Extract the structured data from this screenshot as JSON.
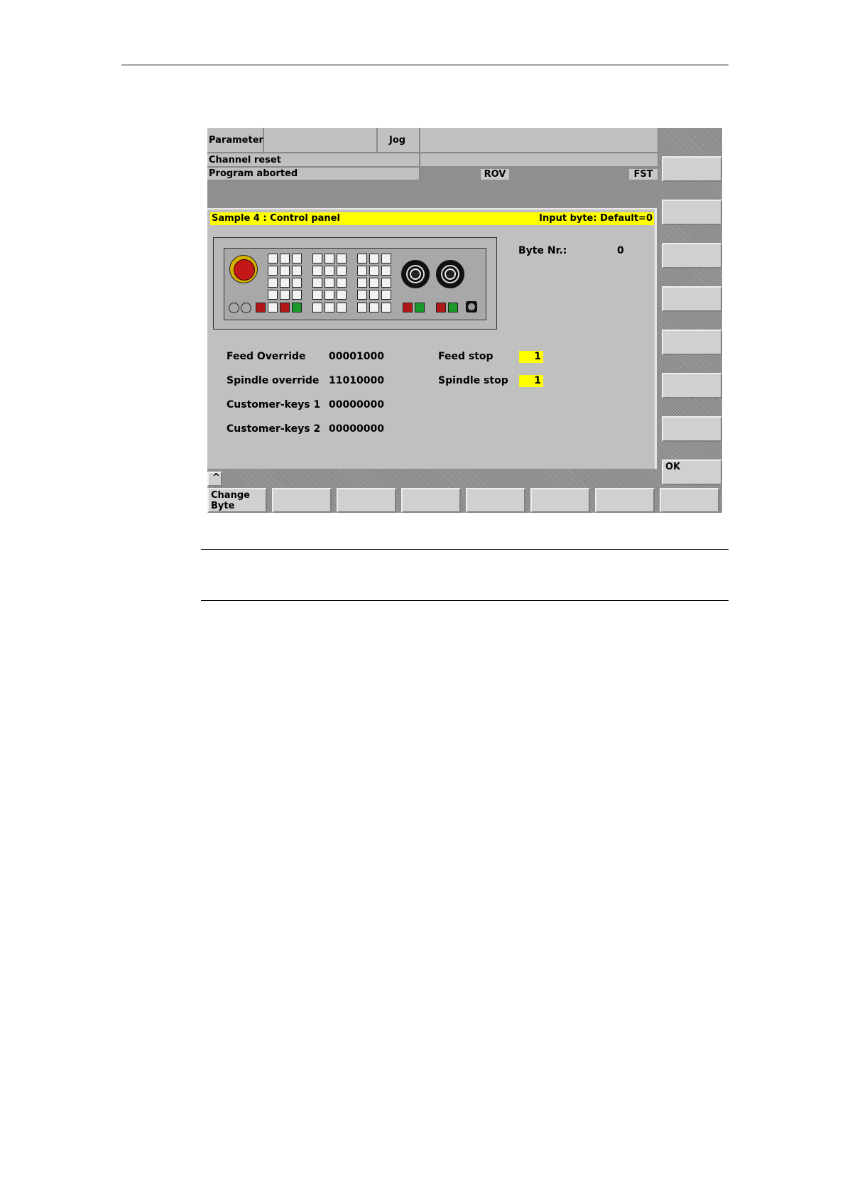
{
  "header": {
    "area": "Parameter",
    "mode": "Jog",
    "channel_status": "Channel reset",
    "program_status": "Program aborted",
    "indicator_1": "ROV",
    "indicator_2": "FST"
  },
  "dialog": {
    "title": "Sample 4 : Control panel",
    "input_info": "Input byte: Default=0",
    "byte_label": "Byte Nr.:",
    "byte_value": "0",
    "rows": [
      {
        "label": "Feed Override",
        "value": "00001000"
      },
      {
        "label": "Spindle override",
        "value": "11010000"
      },
      {
        "label": "Customer-keys 1",
        "value": "00000000"
      },
      {
        "label": "Customer-keys 2",
        "value": "00000000"
      }
    ],
    "flags": [
      {
        "label": "Feed stop",
        "value": "1"
      },
      {
        "label": "Spindle stop",
        "value": "1"
      }
    ]
  },
  "softkeys": {
    "vertical_last": "OK",
    "recall": "^",
    "horizontal_first_line1": "Change",
    "horizontal_first_line2": "Byte"
  },
  "colors": {
    "highlight": "#ffff00",
    "panel_gray": "#c0c0c0",
    "key_red": "#b01818",
    "key_green": "#1a9a2a"
  }
}
